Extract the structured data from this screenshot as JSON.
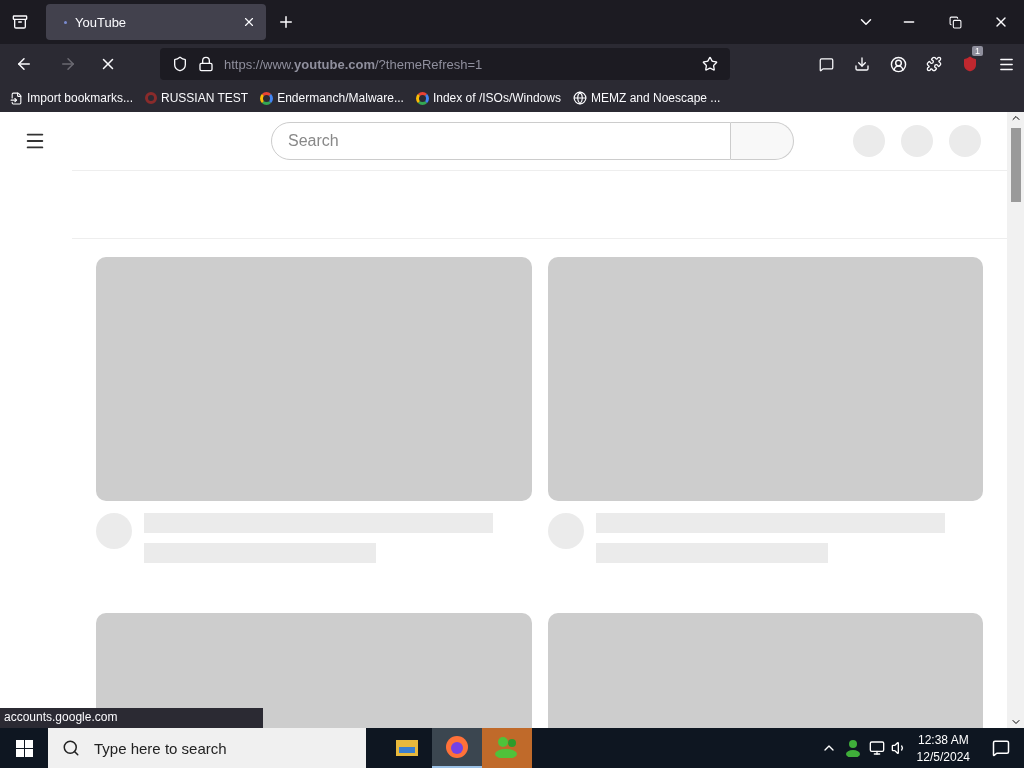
{
  "tabs": [
    {
      "title": "YouTube",
      "selected": true
    }
  ],
  "address_bar": {
    "url": "https://www.**youtube.com**/?themeRefresh=1",
    "loading": true
  },
  "extension_badge": "1",
  "bookmarks": [
    {
      "kind": "import",
      "label": "Import bookmarks..."
    },
    {
      "kind": "ring",
      "label": "RUSSIAN TEST"
    },
    {
      "kind": "google",
      "label": "Endermanch/Malware..."
    },
    {
      "kind": "google",
      "label": "Index of /ISOs/Windows"
    },
    {
      "kind": "globe",
      "label": "MEMZ and Noescape ..."
    }
  ],
  "page": {
    "search": {
      "placeholder": "Search"
    },
    "cards": [
      {
        "kind": "skeleton"
      },
      {
        "kind": "skeleton"
      },
      {
        "kind": "thumbnail_only"
      },
      {
        "kind": "thumbnail_only"
      }
    ]
  },
  "status_link": "accounts.google.com",
  "taskbar": {
    "search": {
      "placeholder": "Type here to search"
    },
    "apps": [
      {
        "kind": "folder",
        "selected": false
      },
      {
        "kind": "firefox",
        "selected": true
      },
      {
        "kind": "people",
        "selected": false
      }
    ],
    "time": "12:38 AM",
    "date": "12/5/2024"
  }
}
